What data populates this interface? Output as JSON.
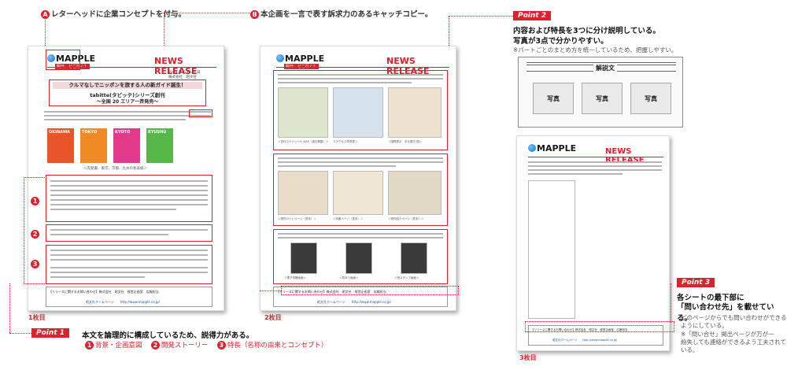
{
  "callouts": {
    "a": {
      "num": "A",
      "text": "レターヘッドに企業コンセプトを付与。"
    },
    "b": {
      "num": "B",
      "text": "本企画を一言で表す訴求力のあるキャッチコピー。"
    }
  },
  "point2": {
    "tag": "Point 2",
    "line1": "内容および特長を3つに分け説明している。",
    "line2": "写真が3点で分かりやすい。",
    "note": "※パートごとのまとめ方を統一しているため、把握しやすい。",
    "diagram": {
      "caption": "解説文",
      "photos": [
        "写真",
        "写真",
        "写真"
      ]
    }
  },
  "point1": {
    "tag": "Point 1",
    "text": "本文を論理的に構成しているため、説得力がある。",
    "items": [
      {
        "num": "1",
        "text": "背景・企画意図"
      },
      {
        "num": "2",
        "text": "開発ストーリー"
      },
      {
        "num": "3",
        "text": "特長（名称の由来とコンセプト）"
      }
    ]
  },
  "point3": {
    "tag": "Point 3",
    "line1": "各シートの最下部に",
    "line2": "「問い合わせ先」を載せている。",
    "note1": "どのページからでも問い合わせができる",
    "note2": "ようにしている。",
    "note3": "※「問い合せ」掲出ページが万が一",
    "note4": "紛失しても連絡ができるよう工夫されて",
    "note5": "いる。"
  },
  "sheets": {
    "s1": {
      "label": "1枚目",
      "date": "2014 年 6 月 23 日",
      "company": "株式会社　昭文社",
      "headline_1": "クルマなしでニッポンを旅する人の新ガイド誕生！",
      "headline_2": "tabitte(タビッテ)シリーズ創刊",
      "headline_3": "〜全国 20 エリア一斉発売〜",
      "caption": "＜先発書、東京、京都、九州の各表紙＞",
      "books": [
        "OKINAWA",
        "TOKYO",
        "KYOTO",
        "KYUSHU"
      ],
      "footer": "【リリースに関するお問い合わせ】株式会社　昭文社　経営企画室　広報担当",
      "footer_url": "昭文社ホームページ　　http://www.mapple.co.jp/"
    },
    "s2": {
      "label": "2枚目",
      "caps_1": [
        "＜週行スケジュール MAP（奥社掲載）＞",
        "＜アクセス早見表＞",
        "＜国際表示　手元周辺 図＞"
      ],
      "caps_2": [
        "＜物件ガイドページ（見本）＞",
        "＜特集ページ（見本）＞",
        "＜物件紹介ページ（見本）＞"
      ],
      "caps_3": [
        "＜電子書籍画面＞",
        "＜見本で画面＞",
        "＜旅スタンプ画面＞"
      ],
      "footer": "【リリースに関するお問い合わせ】株式会社　昭文社　経営企画室　広報担当",
      "footer_url": "昭文社ホームページ　　http://www.mapple.co.jp/"
    },
    "s3": {
      "label": "3枚目",
      "footer": "【リリースに関するお問い合わせ】株式会社　昭文社　経営企画室　広報担当",
      "footer_url": "昭文社ホームページ　　http://www.mapple.co.jp/"
    }
  },
  "brand": {
    "logo": "MAPPLE",
    "tagline": "明日、どこ行く？",
    "news": "NEWS RELEASE"
  }
}
